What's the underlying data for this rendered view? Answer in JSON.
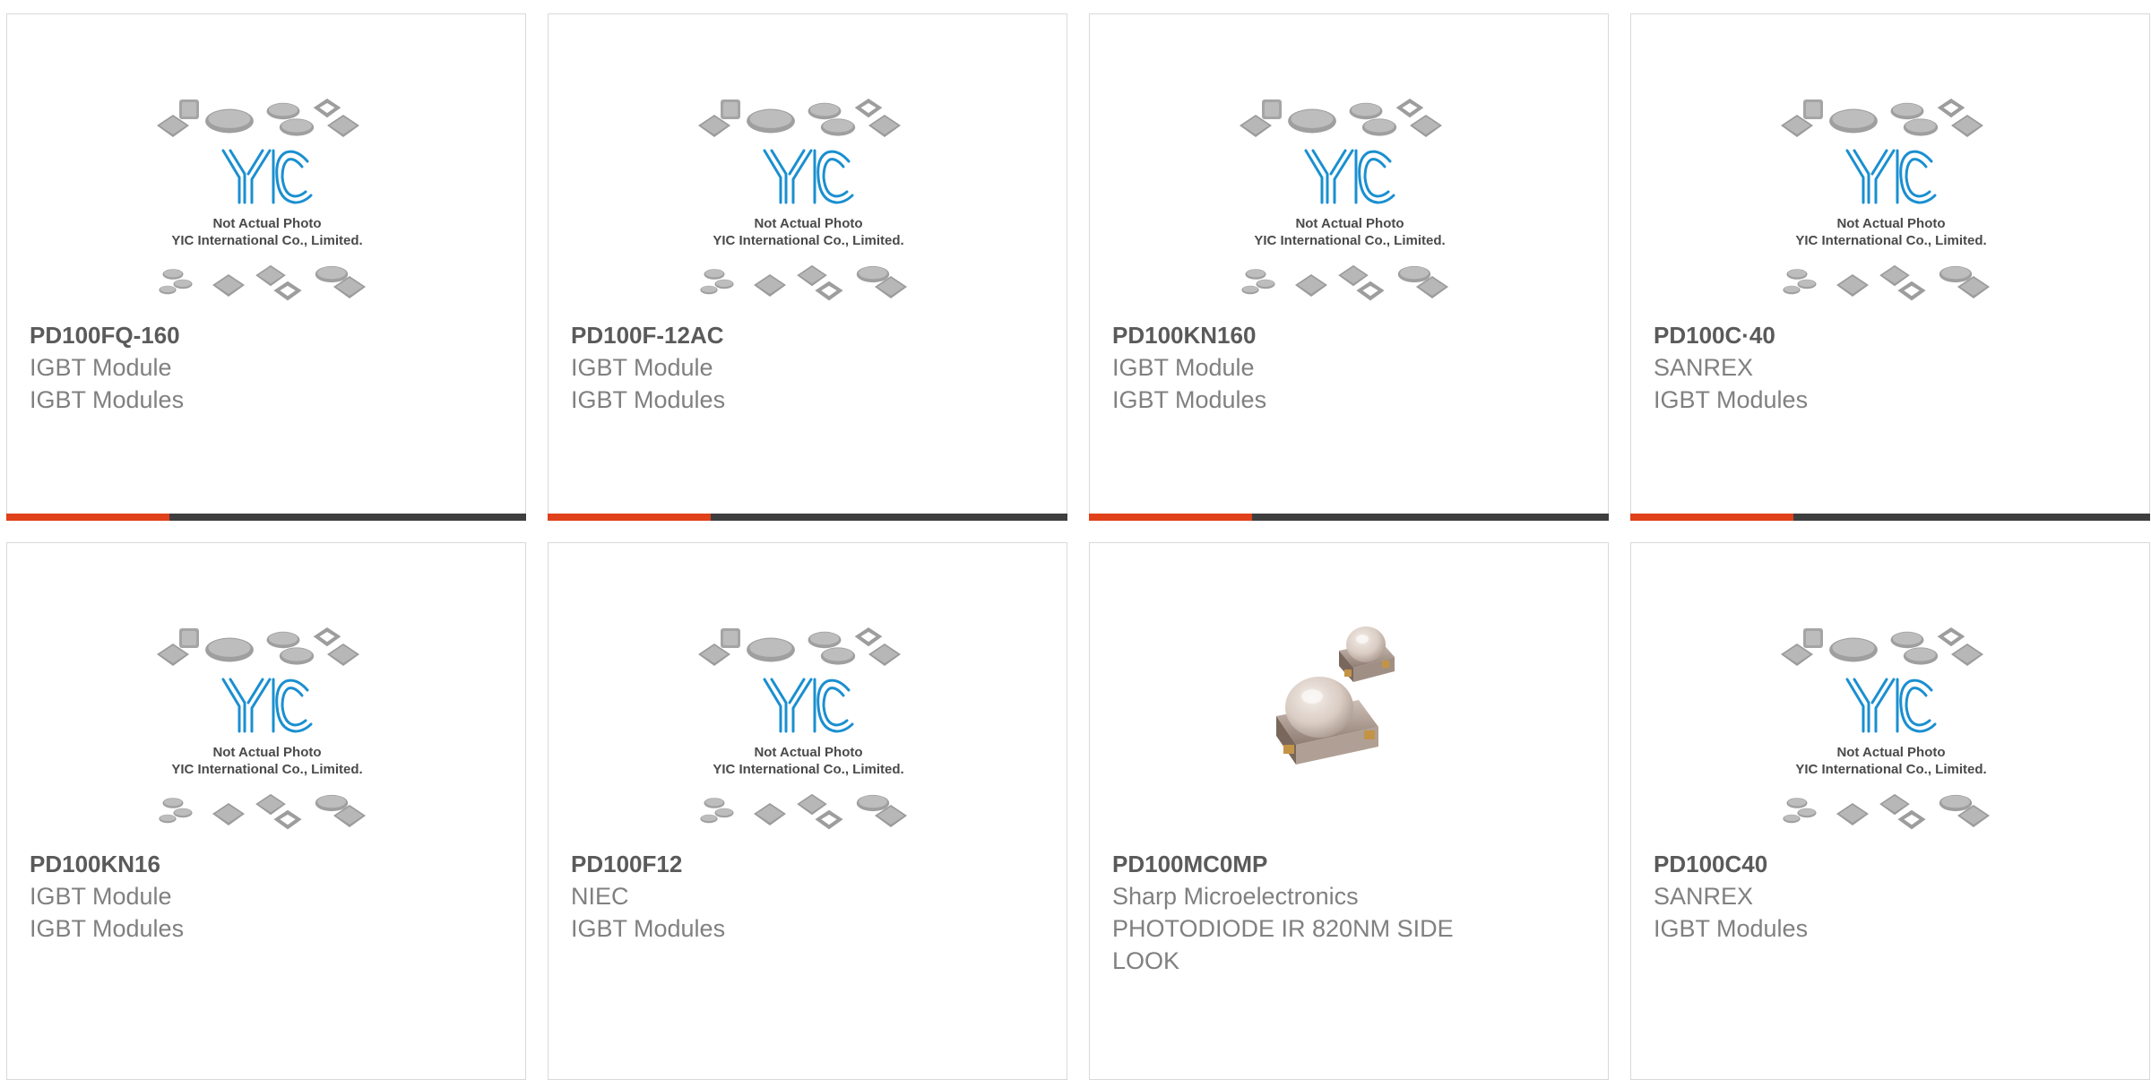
{
  "placeholder_image": {
    "brand": "YIC",
    "line1": "Not Actual Photo",
    "line2": "YIC International Co., Limited."
  },
  "colors": {
    "accent": "#e0401a",
    "bar": "#3e3e3e",
    "part_text": "#5a5a5a",
    "secondary_text": "#808080",
    "logo_blue": "#1a8fd0"
  },
  "products": [
    {
      "part": "PD100FQ-160",
      "maker": "IGBT Module",
      "desc": "IGBT Modules",
      "image": "placeholder"
    },
    {
      "part": "PD100F-12AC",
      "maker": "IGBT Module",
      "desc": "IGBT Modules",
      "image": "placeholder"
    },
    {
      "part": "PD100KN160",
      "maker": "IGBT Module",
      "desc": "IGBT Modules",
      "image": "placeholder"
    },
    {
      "part": "PD100C·40",
      "maker": "SANREX",
      "desc": "IGBT Modules",
      "image": "placeholder"
    },
    {
      "part": "PD100KN16",
      "maker": "IGBT Module",
      "desc": "IGBT Modules",
      "image": "placeholder"
    },
    {
      "part": "PD100F12",
      "maker": "NIEC",
      "desc": "IGBT Modules",
      "image": "placeholder"
    },
    {
      "part": "PD100MC0MP",
      "maker": "Sharp Microelectronics",
      "desc": "PHOTODIODE IR 820NM SIDE LOOK",
      "image": "photodiode-photo"
    },
    {
      "part": "PD100C40",
      "maker": "SANREX",
      "desc": "IGBT Modules",
      "image": "placeholder"
    }
  ]
}
